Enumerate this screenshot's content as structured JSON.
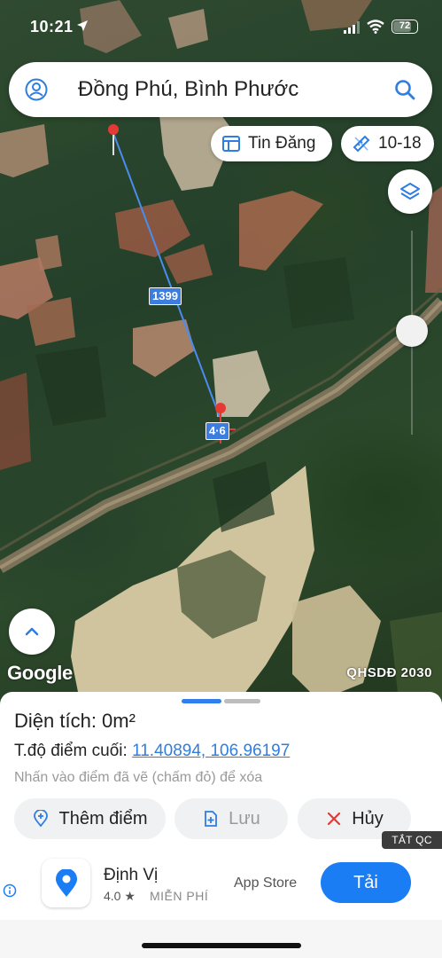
{
  "status_bar": {
    "time": "10:21",
    "battery": "72"
  },
  "search": {
    "query": "Đồng Phú, Bình Phước"
  },
  "chips": {
    "listings_label": "Tin Đăng",
    "zoom_label": "10-18"
  },
  "map": {
    "attribution": "Google",
    "layer_name": "QHSDĐ 2030",
    "distance_label": "1399",
    "second_label": "4·6"
  },
  "sheet": {
    "area_text": "Diện tích: 0m²",
    "last_point_prefix": "T.độ điểm cuối: ",
    "last_point_coords": "11.40894, 106.96197",
    "hint": "Nhấn vào điểm đã vẽ (chấm đỏ) để xóa",
    "add_point_label": "Thêm điểm",
    "save_label": "Lưu",
    "cancel_label": "Hủy"
  },
  "ad": {
    "tag": "TẮT QC",
    "app_name": "Định Vị",
    "rating": "4.0 ★",
    "price": "MIỄN PHÍ",
    "store": "App Store",
    "install_label": "Tải"
  },
  "colors": {
    "accent": "#2f7de1",
    "install": "#1a7df4",
    "line": "#4a8cf0",
    "pin": "#e53935"
  }
}
